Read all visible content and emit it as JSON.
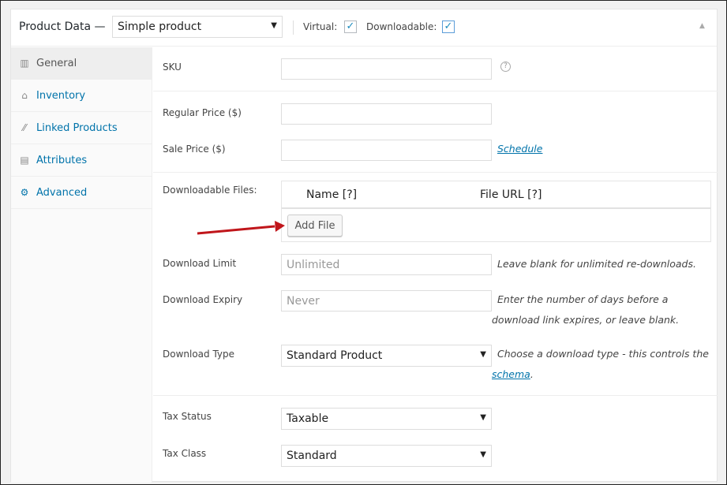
{
  "header": {
    "title": "Product Data —",
    "product_type": "Simple product",
    "virtual_label": "Virtual:",
    "virtual_checked": true,
    "downloadable_label": "Downloadable:",
    "downloadable_checked": true,
    "collapse_icon": "triangle-up-icon"
  },
  "sidebar": {
    "items": [
      {
        "label": "General",
        "icon": "general-icon",
        "active": true
      },
      {
        "label": "Inventory",
        "icon": "inventory-icon"
      },
      {
        "label": "Linked Products",
        "icon": "link-icon"
      },
      {
        "label": "Attributes",
        "icon": "attributes-icon"
      },
      {
        "label": "Advanced",
        "icon": "gear-icon"
      }
    ]
  },
  "fields": {
    "sku": {
      "label": "SKU",
      "value": "",
      "help": "?"
    },
    "regular_price": {
      "label": "Regular Price ($)",
      "value": ""
    },
    "sale_price": {
      "label": "Sale Price ($)",
      "value": "",
      "link": "Schedule"
    },
    "downloadable_files": {
      "label": "Downloadable Files:",
      "col_name": "Name [?]",
      "col_url": "File URL [?]",
      "add_button": "Add File"
    },
    "download_limit": {
      "label": "Download Limit",
      "placeholder": "Unlimited",
      "hint": "Leave blank for unlimited re-downloads."
    },
    "download_expiry": {
      "label": "Download Expiry",
      "placeholder": "Never",
      "hint": "Enter the number of days before a download link expires, or leave blank."
    },
    "download_type": {
      "label": "Download Type",
      "value": "Standard Product",
      "hint": "Choose a download type - this controls the",
      "hint_link": "schema",
      "hint_end": "."
    },
    "tax_status": {
      "label": "Tax Status",
      "value": "Taxable"
    },
    "tax_class": {
      "label": "Tax Class",
      "value": "Standard"
    }
  },
  "colors": {
    "accent": "#0073aa",
    "arrow": "#c0161b"
  }
}
